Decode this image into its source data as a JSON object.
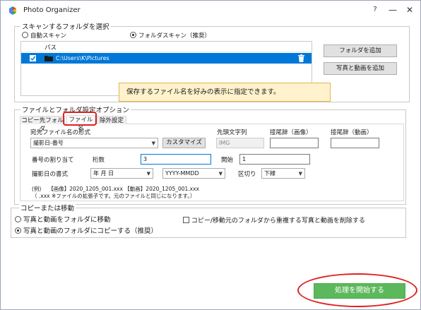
{
  "window": {
    "title": "Photo Organizer"
  },
  "titlebar": {
    "help": "?",
    "minimize": "—",
    "close": "✕"
  },
  "scan": {
    "group_title": "スキャンするフォルダを選択",
    "radio_auto": "自動スキャン",
    "radio_folder": "フォルダスキャン（推奨）",
    "column_path": "パス",
    "rows": [
      {
        "path": "C:\\Users\\K\\Pictures"
      }
    ],
    "btn_add_folder": "フォルダを追加",
    "btn_add_media": "写真と動画を追加"
  },
  "tooltip": {
    "text": "保存するファイル名を好みの表示に指定できます。"
  },
  "options": {
    "group_title": "ファイルとフォルダ設定オプション",
    "tabs": [
      "コピー先フォルダ",
      "ファイル名",
      "除外設定"
    ],
    "filename_format_label": "宛先ファイル名の形式",
    "filename_format_value": "撮影日-番号",
    "customize_btn": "カスタマイズ",
    "prefix_label": "先頭文字列",
    "prefix_value": "IMG",
    "suffix_image_label": "接尾辞（画像）",
    "suffix_video_label": "接尾辞（動画）",
    "numbering_label": "番号の割り当て",
    "digits_label": "桁数",
    "digits_value": "3",
    "start_label": "開始",
    "start_value": "1",
    "date_format_label": "撮影日の書式",
    "date_order_value": "年 月 日",
    "date_pattern_value": "YYYY-MMDD",
    "separator_label": "区切り",
    "separator_value": "下線",
    "example_line1": "(例)　 【画像】2020_1205_001.xxx 【動画】2020_1205_001.xxx",
    "example_line2": "（ .xxx ※ファイルの拡張子です。元のファイルと同じになります。）"
  },
  "copy_move": {
    "group_title": "コピーまたは移動",
    "radio_move": "写真と動画をフォルダに移動",
    "radio_copy": "写真と動画のフォルダにコピーする（推奨）",
    "delete_dup": "コピー/移動元のフォルダから重複する写真と動画を削除する"
  },
  "start_button": "処理を開始する",
  "colors": {
    "accent": "#0078d7",
    "start_green": "#5cb85c",
    "highlight_red": "#e02020",
    "tooltip_bg": "#fff2cc"
  }
}
